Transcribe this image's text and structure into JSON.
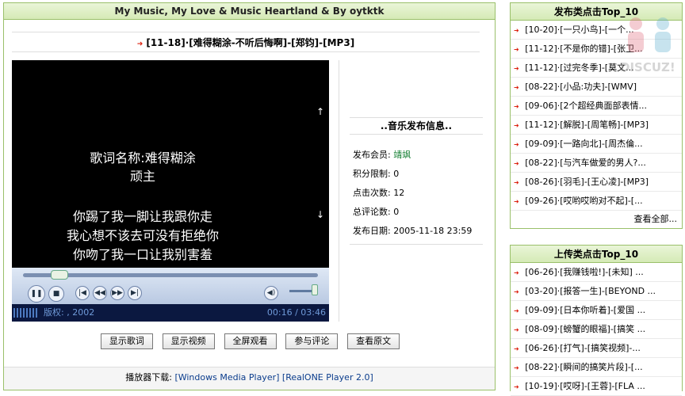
{
  "main": {
    "header": "My Music, My Love & Music Heartland & By oytktk",
    "song_title": "[11-18]·[难得糊涂-不听后悔啊]-[郑钧]-[MP3]",
    "lyrics": [
      "歌词名称:难得糊涂",
      "顽主",
      "",
      "你踢了我一脚让我跟你走",
      "我心想不该去可没有拒绝你",
      "你吻了我一口让我别害羞"
    ],
    "player": {
      "copyright": "版权: , 2002",
      "time": "00:16 / 03:46",
      "progress_fraction": 0.07
    },
    "info": {
      "heading": "..音乐发布信息..",
      "rows": [
        {
          "label": "发布会员:",
          "value": "靖飒"
        },
        {
          "label": "积分限制:",
          "value": "0"
        },
        {
          "label": "点击次数:",
          "value": "12"
        },
        {
          "label": "总评论数:",
          "value": "0"
        },
        {
          "label": "发布日期:",
          "value": "2005-11-18 23:59"
        }
      ]
    },
    "buttons": [
      "显示歌词",
      "显示视频",
      "全屏观看",
      "参与评论",
      "查看原文"
    ],
    "download": {
      "label": "播放器下载:",
      "link1": "[Windows Media Player]",
      "link2": "[RealONE Player 2.0]"
    }
  },
  "sidebar_publish": {
    "title": "发布类点击Top_10",
    "items": [
      "[10-20]·[一只小鸟]-[一个...",
      "[11-12]·[不是你的错]-[张卫...",
      "[11-12]·[过完冬季]-[莫文...",
      "[08-22]·[小品:功夫]-[WMV]",
      "[09-06]·[2个超经典面部表情...",
      "[11-12]·[解脱]-[周笔畅]-[MP3]",
      "[09-09]·[一路向北]-[周杰倫...",
      "[08-22]·[与汽车做爱的男人?...",
      "[08-26]·[羽毛]-[王心凌]-[MP3]",
      "[09-26]·[哎哟哎哟对不起]-[..."
    ],
    "more": "查看全部..."
  },
  "sidebar_upload": {
    "title": "上传类点击Top_10",
    "items": [
      "[06-26]·[我赚钱啦!]-[未知] ...",
      "[03-20]·[报答一生]-[BEYOND ...",
      "[09-09]·[日本你听着]-[爱国 ...",
      "[08-09]·[螃蟹的眼福]-[搞笑 ...",
      "[06-26]·[打气]-[搞笑视频]-...",
      "[08-22]·[瞬间的搞笑片段]-[...",
      "[10-19]·[哎呀]-[王蓉]-[FLA ..."
    ]
  },
  "colors": {
    "accent_green": "#9ac06a",
    "arrow_red": "#d21"
  }
}
